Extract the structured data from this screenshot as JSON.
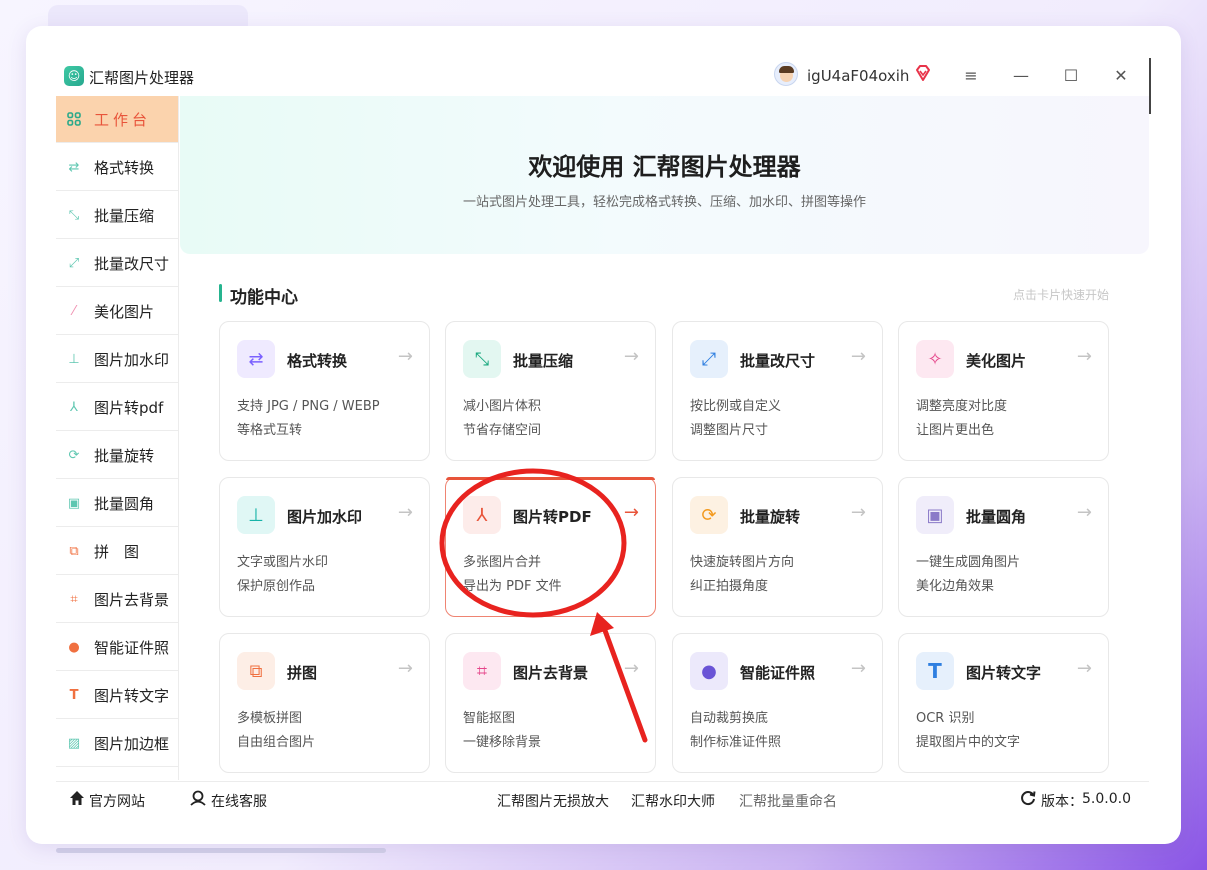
{
  "app": {
    "title": "汇帮图片处理器",
    "username": "igU4aF04oxih",
    "logo_icon": "app-logo-icon"
  },
  "window_controls": {
    "menu": "≡",
    "minimize": "—",
    "maximize": "☐",
    "close": "✕"
  },
  "sidebar": {
    "items": [
      {
        "label": "工作台",
        "icon": "grid-icon",
        "active": true
      },
      {
        "label": "格式转换",
        "icon": "convert-icon"
      },
      {
        "label": "批量压缩",
        "icon": "compress-icon"
      },
      {
        "label": "批量改尺寸",
        "icon": "resize-icon"
      },
      {
        "label": "美化图片",
        "icon": "magic-wand-icon"
      },
      {
        "label": "图片加水印",
        "icon": "stamp-icon"
      },
      {
        "label": "图片转pdf",
        "icon": "pdf-icon"
      },
      {
        "label": "批量旋转",
        "icon": "rotate-icon"
      },
      {
        "label": "批量圆角",
        "icon": "image-icon"
      },
      {
        "label": "拼　图",
        "icon": "collage-icon"
      },
      {
        "label": "图片去背景",
        "icon": "crop-icon"
      },
      {
        "label": "智能证件照",
        "icon": "person-icon"
      },
      {
        "label": "图片转文字",
        "icon": "text-icon"
      },
      {
        "label": "图片加边框",
        "icon": "frame-icon"
      }
    ]
  },
  "hero": {
    "title": "欢迎使用 汇帮图片处理器",
    "subtitle": "一站式图片处理工具，轻松完成格式转换、压缩、加水印、拼图等操作"
  },
  "section": {
    "title": "功能中心",
    "hint": "点击卡片快速开始"
  },
  "cards": [
    {
      "title": "格式转换",
      "desc1": "支持 JPG / PNG / WEBP",
      "desc2": "等格式互转",
      "icon": "convert-icon",
      "color": "#7b61ff",
      "bg": "#efeaff"
    },
    {
      "title": "批量压缩",
      "desc1": "减小图片体积",
      "desc2": "节省存储空间",
      "icon": "compress-icon",
      "color": "#1aa87f",
      "bg": "#e3f7f1"
    },
    {
      "title": "批量改尺寸",
      "desc1": "按比例或自定义",
      "desc2": "调整图片尺寸",
      "icon": "resize-icon",
      "color": "#2f7fe0",
      "bg": "#e6f0fc"
    },
    {
      "title": "美化图片",
      "desc1": "调整亮度对比度",
      "desc2": "让图片更出色",
      "icon": "magic-wand-icon",
      "color": "#e5458a",
      "bg": "#fde8f1"
    },
    {
      "title": "图片加水印",
      "desc1": "文字或图片水印",
      "desc2": "保护原创作品",
      "icon": "stamp-icon",
      "color": "#16b3a8",
      "bg": "#e0f7f5"
    },
    {
      "title": "图片转PDF",
      "desc1": "多张图片合并",
      "desc2": "导出为 PDF 文件",
      "icon": "pdf-icon",
      "color": "#e8543a",
      "bg": "#fdecea",
      "highlight": true
    },
    {
      "title": "批量旋转",
      "desc1": "快速旋转图片方向",
      "desc2": "纠正拍摄角度",
      "icon": "rotate-icon",
      "color": "#f39a1f",
      "bg": "#fdf1e2"
    },
    {
      "title": "批量圆角",
      "desc1": "一键生成圆角图片",
      "desc2": "美化边角效果",
      "icon": "image-icon",
      "color": "#8b7ac8",
      "bg": "#f0edfa"
    },
    {
      "title": "拼图",
      "desc1": "多模板拼图",
      "desc2": "自由组合图片",
      "icon": "collage-icon",
      "color": "#f07040",
      "bg": "#fdeee6"
    },
    {
      "title": "图片去背景",
      "desc1": "智能抠图",
      "desc2": "一键移除背景",
      "icon": "crop-icon",
      "color": "#e5458a",
      "bg": "#fde8f1"
    },
    {
      "title": "智能证件照",
      "desc1": "自动裁剪换底",
      "desc2": "制作标准证件照",
      "icon": "person-icon",
      "color": "#6a54d6",
      "bg": "#ece9fb"
    },
    {
      "title": "图片转文字",
      "desc1": "OCR 识别",
      "desc2": "提取图片中的文字",
      "icon": "text-icon",
      "color": "#2f7fe0",
      "bg": "#e6f0fc"
    }
  ],
  "footer": {
    "website": "官方网站",
    "support": "在线客服",
    "link1": "汇帮图片无损放大",
    "link2": "汇帮水印大师",
    "link3": "汇帮批量重命名",
    "version_label": "版本：",
    "version": "5.0.0.0"
  },
  "colors": {
    "accent": "#e8543a",
    "primary": "#26b48f",
    "active_bg": "#fbd3ad"
  }
}
